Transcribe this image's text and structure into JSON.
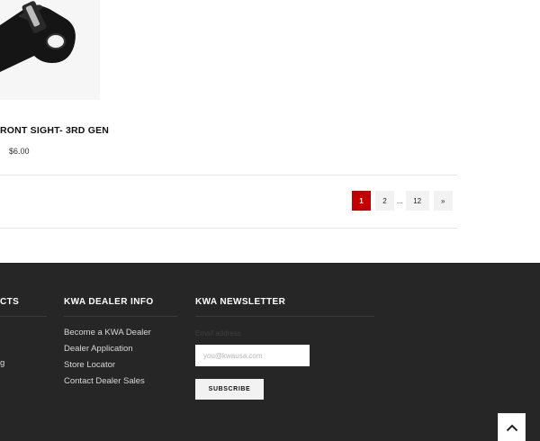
{
  "product": {
    "title": "RONT SIGHT- 3RD GEN",
    "price": "$6.00",
    "image_icon": "rear-sight-part-icon"
  },
  "pagination": {
    "pages": [
      "1",
      "2"
    ],
    "ellipsis": "...",
    "last_page": "12",
    "next_label": "»",
    "current_page": "1"
  },
  "footer": {
    "col1": {
      "heading": "CTS",
      "links_partial": [
        "g"
      ]
    },
    "dealer": {
      "heading": "KWA DEALER INFO",
      "links": [
        "Become a KWA Dealer",
        "Dealer Application",
        "Store Locator",
        "Contact Dealer Sales"
      ]
    },
    "newsletter": {
      "heading": "KWA NEWSLETTER",
      "email_label": "Email address",
      "email_placeholder": "you@kwausa.com",
      "subscribe_label": "SUBSCRIBE"
    }
  },
  "back_to_top_icon": "chevron-up-icon",
  "colors": {
    "accent_red": "#c00000",
    "footer_bg": "#262626"
  }
}
